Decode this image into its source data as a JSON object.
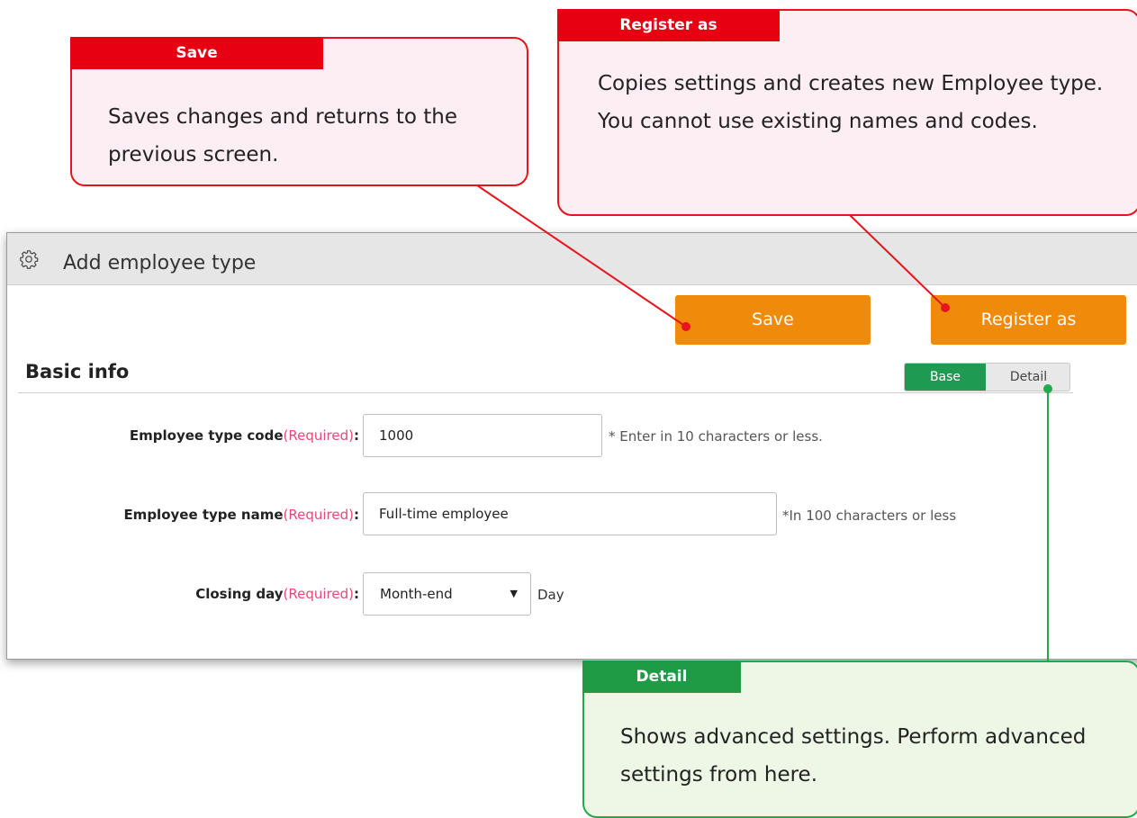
{
  "callouts": {
    "save": {
      "tag": "Save",
      "text": "Saves changes and returns to the previous screen."
    },
    "register_as": {
      "tag": "Register as",
      "text": "Copies settings and creates new Employee type. You cannot use existing names and codes."
    },
    "detail": {
      "tag": "Detail",
      "text": "Shows advanced settings. Perform advanced settings from here."
    }
  },
  "window": {
    "title": "Add employee type",
    "title_icon": "gear-icon"
  },
  "toolbar": {
    "save_label": "Save",
    "register_label": "Register as"
  },
  "section": {
    "title": "Basic info",
    "tabs": {
      "base": "Base",
      "detail": "Detail",
      "active": "Base"
    }
  },
  "form": {
    "code": {
      "label": "Employee type code",
      "required": "(Required)",
      "colon": ":",
      "value": "1000",
      "hint": "* Enter in 10 characters or less."
    },
    "name": {
      "label": "Employee type name",
      "required": "(Required)",
      "colon": ":",
      "value": "Full-time employee",
      "hint": "*In 100 characters or less"
    },
    "closing": {
      "label": "Closing day",
      "required": "(Required)",
      "colon": ":",
      "value": "Month-end",
      "suffix": "Day"
    }
  },
  "colors": {
    "callout_red": "#e60012",
    "callout_green": "#1f9a45",
    "button_orange": "#f08a0b",
    "required_pink": "#e8497a"
  }
}
